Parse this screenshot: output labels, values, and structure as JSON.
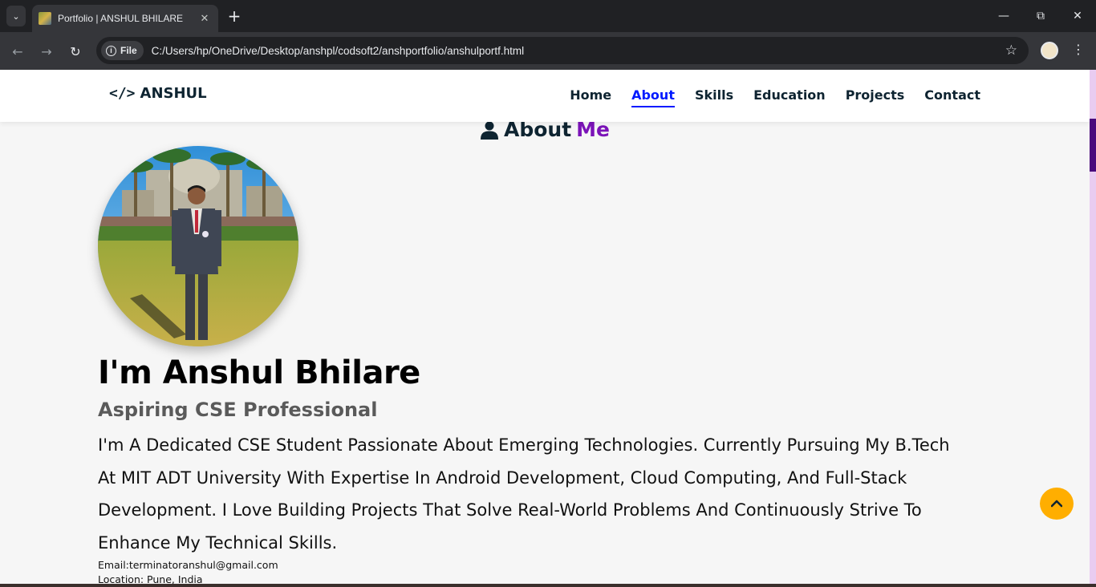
{
  "browser": {
    "tab_title": "Portfolio | ANSHUL BHILARE",
    "address_chip": "File",
    "url": "C:/Users/hp/OneDrive/Desktop/anshpl/codsoft2/anshportfolio/anshulportf.html"
  },
  "site": {
    "brand": "ANSHUL",
    "brand_symbol": "</>",
    "nav": [
      {
        "label": "Home",
        "active": false
      },
      {
        "label": "About",
        "active": true
      },
      {
        "label": "Skills",
        "active": false
      },
      {
        "label": "Education",
        "active": false
      },
      {
        "label": "Projects",
        "active": false
      },
      {
        "label": "Contact",
        "active": false
      }
    ],
    "accent_color": "#7b13b8",
    "nav_active_color": "#011aff",
    "to_top_color": "#ffae00"
  },
  "about": {
    "heading": "About",
    "heading_accent": "Me",
    "name": "I'm Anshul Bhilare",
    "tagline": "Aspiring CSE Professional",
    "bio": "I'm A Dedicated CSE Student Passionate About Emerging Technologies. Currently Pursuing My B.Tech At MIT ADT University With Expertise In Android Development, Cloud Computing, And Full-Stack Development. I Love Building Projects That Solve Real-World Problems And Continuously Strive To Enhance My Technical Skills.",
    "email": "Email:terminatoranshul@gmail.com",
    "location": "Location: Pune, India"
  },
  "icons": {
    "heading_icon": "user-icon",
    "to_top_icon": "chevron-up-icon"
  }
}
